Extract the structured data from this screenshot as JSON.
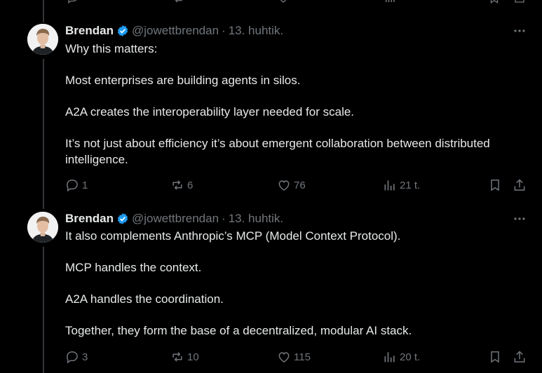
{
  "colors": {
    "background": "#000000",
    "text": "#e7e9ea",
    "muted": "#71767b",
    "verified": "#1d9bf0",
    "thread_line": "#333639"
  },
  "tweets": [
    {
      "author": "Brendan",
      "handle": "@jowettbrendan",
      "separator": "·",
      "date": "13. huhtik.",
      "paragraphs": [
        "Why this matters:",
        "Most enterprises are building agents in silos.",
        "A2A creates the interoperability layer needed for scale.",
        "It’s not just about efficiency it’s about emergent collaboration between distributed intelligence."
      ],
      "replies": "1",
      "reposts": "6",
      "likes": "76",
      "views": "21 t."
    },
    {
      "author": "Brendan",
      "handle": "@jowettbrendan",
      "separator": "·",
      "date": "13. huhtik.",
      "paragraphs": [
        "It also complements Anthropic’s MCP (Model Context Protocol).",
        "MCP handles the context.",
        "A2A handles the coordination.",
        "Together, they form the base of a decentralized, modular AI stack."
      ],
      "replies": "3",
      "reposts": "10",
      "likes": "115",
      "views": "20 t."
    }
  ],
  "icons": {
    "reply": "reply-icon",
    "repost": "repost-icon",
    "like": "heart-icon",
    "views": "views-icon",
    "bookmark": "bookmark-icon",
    "share": "share-icon",
    "more": "more-icon",
    "verified": "verified-badge-icon"
  }
}
